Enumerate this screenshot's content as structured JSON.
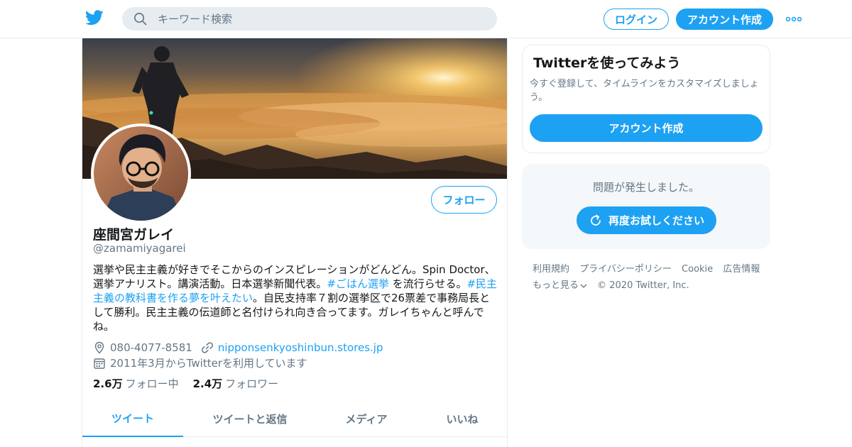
{
  "header": {
    "search_placeholder": "キーワード検索",
    "login_label": "ログイン",
    "signup_label": "アカウント作成"
  },
  "profile": {
    "name": "座間宮ガレイ",
    "handle": "@zamamiyagarei",
    "follow_label": "フォロー",
    "bio": {
      "part1": "選挙や民主主義が好きでそこからのインスピレーションがどんどん。Spin Doctor、選挙アナリスト。講演活動。日本選挙新聞代表。",
      "hashtag1": "#ごはん選挙",
      "part2": " を流行らせる。",
      "hashtag2": "#民主主義の教科書を作る夢を叶えたい",
      "part3": "。自民支持率７割の選挙区で26票差で事務局長として勝利。民主主義の伝道師と名付けられ向き合ってます。ガレイちゃんと呼んでね。"
    },
    "location": "080-4077-8581",
    "website": "nipponsenkyoshinbun.stores.jp",
    "joined": "2011年3月からTwitterを利用しています",
    "following_count": "2.6万",
    "following_label": "フォロー中",
    "followers_count": "2.4万",
    "followers_label": "フォロワー",
    "tabs": [
      {
        "label": "ツイート"
      },
      {
        "label": "ツイートと返信"
      },
      {
        "label": "メディア"
      },
      {
        "label": "いいね"
      }
    ]
  },
  "sidebar": {
    "signup_card": {
      "title": "Twitterを使ってみよう",
      "subtitle": "今すぐ登録して、タイムラインをカスタマイズしましょう。",
      "button_label": "アカウント作成"
    },
    "error_card": {
      "message": "問題が発生しました。",
      "retry_label": "再度お試しください"
    },
    "footer": {
      "links": [
        "利用規約",
        "プライバシーポリシー",
        "Cookie",
        "広告情報",
        "もっと見る"
      ],
      "copyright": "© 2020 Twitter, Inc."
    }
  },
  "colors": {
    "brand": "#1da1f2",
    "text_primary": "#14171a",
    "text_secondary": "#657786",
    "border": "#e6ecf0"
  },
  "icons": [
    "twitter-bird-icon",
    "search-icon",
    "more-dots-icon",
    "location-icon",
    "link-icon",
    "calendar-icon",
    "refresh-icon",
    "chevron-down-icon"
  ]
}
